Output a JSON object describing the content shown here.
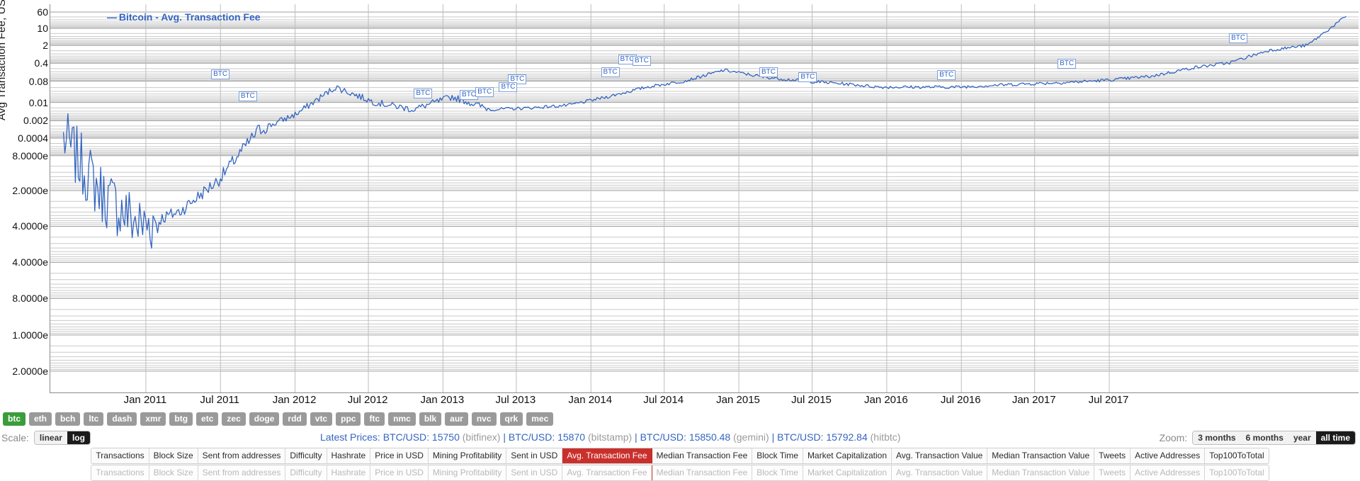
{
  "chart_data": {
    "type": "line",
    "title": "Bitcoin - Avg. Transaction Fee",
    "legend_label": "Bitcoin - Avg. Transaction Fee",
    "legend_position": "top-left",
    "scale": "log",
    "grid": true,
    "xlabel": "",
    "ylabel": "Avg Transaction Fee, USD",
    "ytick_labels": [
      "60",
      "10",
      "2",
      "0.4",
      "0.08",
      "0.01",
      "0.002",
      "0.0004",
      "8.0000e",
      "2.0000e",
      "4.0000e",
      "4.0000e",
      "8.0000e",
      "1.0000e",
      "2.0000e"
    ],
    "ytick_labels_visible": [
      "60",
      "10",
      "2",
      "0.4",
      "0.08",
      "0.01",
      "0.002",
      "0.0004",
      "8.0000e",
      "2.0000e",
      "4.0000e",
      "4.0000e",
      "8.0000e",
      "1.0000e"
    ],
    "xtick_labels": [
      "Jan 2011",
      "Jul 2011",
      "Jan 2012",
      "Jul 2012",
      "Jan 2013",
      "Jul 2013",
      "Jan 2014",
      "Jul 2014",
      "Jan 2015",
      "Jul 2015",
      "Jan 2016",
      "Jul 2016",
      "Jan 2017",
      "Jul 2017"
    ],
    "ylim_top_label": "60",
    "series_name": "Bitcoin - Avg. Transaction Fee",
    "series_color": "#3465c0",
    "annotations": [
      "BTC",
      "BTC",
      "BTC",
      "BTC",
      "BTC",
      "BTC",
      "BTC",
      "BTC",
      "BTC",
      "BTC",
      "BTC",
      "BTC",
      "BTC",
      "BTC",
      "BTC",
      "BTC"
    ],
    "x": [
      "2010-08",
      "2010-09",
      "2010-10",
      "2010-11",
      "2010-12",
      "2011-01",
      "2011-03",
      "2011-06",
      "2011-09",
      "2011-12",
      "2012-03",
      "2012-06",
      "2012-09",
      "2012-12",
      "2013-03",
      "2013-06",
      "2013-09",
      "2013-12",
      "2014-03",
      "2014-06",
      "2014-09",
      "2014-12",
      "2015-03",
      "2015-06",
      "2015-09",
      "2015-12",
      "2016-03",
      "2016-06",
      "2016-09",
      "2016-12",
      "2017-03",
      "2017-06",
      "2017-09",
      "2017-12"
    ],
    "values": [
      0.0004,
      2e-06,
      1e-07,
      4e-07,
      8e-06,
      0.0008,
      0.004,
      0.05,
      0.012,
      0.006,
      0.02,
      0.006,
      0.007,
      0.009,
      0.02,
      0.05,
      0.09,
      0.25,
      0.13,
      0.09,
      0.07,
      0.05,
      0.05,
      0.05,
      0.06,
      0.07,
      0.08,
      0.1,
      0.14,
      0.3,
      0.5,
      1.6,
      2.6,
      40
    ]
  },
  "legend": {
    "dash": "—",
    "label": "Bitcoin - Avg. Transaction Fee"
  },
  "axis": {
    "ylabel": "Avg Transaction Fee, USD",
    "yticks": [
      {
        "label": "60",
        "pos": 2.0
      },
      {
        "label": "10",
        "pos": 6.2
      },
      {
        "label": "2",
        "pos": 10.6
      },
      {
        "label": "0.4",
        "pos": 15.2
      },
      {
        "label": "0.08",
        "pos": 19.8
      },
      {
        "label": "0.01",
        "pos": 25.3
      },
      {
        "label": "0.002",
        "pos": 30.0
      },
      {
        "label": "0.0004",
        "pos": 34.5
      },
      {
        "label": "8.0000e",
        "pos": 39.0
      },
      {
        "label": "2.0000e",
        "pos": 48.0
      },
      {
        "label": "4.0000e",
        "pos": 57.2
      },
      {
        "label": "4.0000e",
        "pos": 66.5
      },
      {
        "label": "8.0000e",
        "pos": 75.8
      },
      {
        "label": "1.0000e",
        "pos": 85.2
      },
      {
        "label": "2.0000e",
        "pos": 94.5
      }
    ],
    "xticks": [
      {
        "label": "Jan 2011",
        "pos": 7.3
      },
      {
        "label": "Jul 2011",
        "pos": 13.0
      },
      {
        "label": "Jan 2012",
        "pos": 18.7
      },
      {
        "label": "Jul 2012",
        "pos": 24.3
      },
      {
        "label": "Jan 2013",
        "pos": 30.0
      },
      {
        "label": "Jul 2013",
        "pos": 35.6
      },
      {
        "label": "Jan 2014",
        "pos": 41.3
      },
      {
        "label": "Jul 2014",
        "pos": 46.9
      },
      {
        "label": "Jan 2015",
        "pos": 52.6
      },
      {
        "label": "Jul 2015",
        "pos": 58.2
      },
      {
        "label": "Jan 2016",
        "pos": 63.9
      },
      {
        "label": "Jul 2016",
        "pos": 69.6
      },
      {
        "label": "Jan 2017",
        "pos": 75.2
      },
      {
        "label": "Jul 2017",
        "pos": 80.9
      }
    ],
    "btc_markers": [
      {
        "label": "BTC",
        "x": 13.0,
        "y": 18.1
      },
      {
        "label": "BTC",
        "x": 15.1,
        "y": 23.8
      },
      {
        "label": "BTC",
        "x": 28.5,
        "y": 23.0
      },
      {
        "label": "BTC",
        "x": 32.0,
        "y": 23.4
      },
      {
        "label": "BTC",
        "x": 33.2,
        "y": 22.6
      },
      {
        "label": "BTC",
        "x": 35.7,
        "y": 19.4
      },
      {
        "label": "BTC",
        "x": 35.0,
        "y": 21.4
      },
      {
        "label": "BTC",
        "x": 42.8,
        "y": 17.5
      },
      {
        "label": "BTC",
        "x": 44.1,
        "y": 14.2
      },
      {
        "label": "BTC",
        "x": 45.2,
        "y": 14.6
      },
      {
        "label": "BTC",
        "x": 54.9,
        "y": 17.6
      },
      {
        "label": "BTC",
        "x": 57.9,
        "y": 18.8
      },
      {
        "label": "BTC",
        "x": 68.5,
        "y": 18.2
      },
      {
        "label": "BTC",
        "x": 77.7,
        "y": 15.4
      },
      {
        "label": "BTC",
        "x": 90.8,
        "y": 8.8
      }
    ]
  },
  "coins": [
    {
      "symbol": "btc",
      "active": true
    },
    {
      "symbol": "eth",
      "active": false
    },
    {
      "symbol": "bch",
      "active": false
    },
    {
      "symbol": "ltc",
      "active": false
    },
    {
      "symbol": "dash",
      "active": false
    },
    {
      "symbol": "xmr",
      "active": false
    },
    {
      "symbol": "btg",
      "active": false
    },
    {
      "symbol": "etc",
      "active": false
    },
    {
      "symbol": "zec",
      "active": false
    },
    {
      "symbol": "doge",
      "active": false
    },
    {
      "symbol": "rdd",
      "active": false
    },
    {
      "symbol": "vtc",
      "active": false
    },
    {
      "symbol": "ppc",
      "active": false
    },
    {
      "symbol": "ftc",
      "active": false
    },
    {
      "symbol": "nmc",
      "active": false
    },
    {
      "symbol": "blk",
      "active": false
    },
    {
      "symbol": "aur",
      "active": false
    },
    {
      "symbol": "nvc",
      "active": false
    },
    {
      "symbol": "qrk",
      "active": false
    },
    {
      "symbol": "mec",
      "active": false
    }
  ],
  "scale_control": {
    "label": "Scale:",
    "linear": "linear",
    "log": "log",
    "selected": "log"
  },
  "prices": {
    "title": "Latest Prices:",
    "items": [
      {
        "pair": "BTC/USD: 15750",
        "exchange": "(bitfinex)"
      },
      {
        "pair": "BTC/USD: 15870",
        "exchange": "(bitstamp)"
      },
      {
        "pair": "BTC/USD: 15850.48",
        "exchange": "(gemini)"
      },
      {
        "pair": "BTC/USD: 15792.84",
        "exchange": "(hitbtc)"
      }
    ],
    "separator": "|"
  },
  "zoom_control": {
    "label": "Zoom:",
    "options": [
      "3 months",
      "6 months",
      "year",
      "all time"
    ],
    "selected": "all time"
  },
  "metrics": [
    {
      "label": "Transactions",
      "selected": false
    },
    {
      "label": "Block Size",
      "selected": false
    },
    {
      "label": "Sent from addresses",
      "selected": false
    },
    {
      "label": "Difficulty",
      "selected": false
    },
    {
      "label": "Hashrate",
      "selected": false
    },
    {
      "label": "Price in USD",
      "selected": false
    },
    {
      "label": "Mining Profitability",
      "selected": false
    },
    {
      "label": "Sent in USD",
      "selected": false
    },
    {
      "label": "Avg. Transaction Fee",
      "selected": true
    },
    {
      "label": "Median Transaction Fee",
      "selected": false
    },
    {
      "label": "Block Time",
      "selected": false
    },
    {
      "label": "Market Capitalization",
      "selected": false
    },
    {
      "label": "Avg. Transaction Value",
      "selected": false
    },
    {
      "label": "Median Transaction Value",
      "selected": false
    },
    {
      "label": "Tweets",
      "selected": false
    },
    {
      "label": "Active Addresses",
      "selected": false
    },
    {
      "label": "Top100ToTotal",
      "selected": false
    }
  ],
  "colors": {
    "series": "#3465c0",
    "selected_metric": "#c9302c",
    "active_coin": "#3b9c3b",
    "grid": "#b9b9b9"
  }
}
